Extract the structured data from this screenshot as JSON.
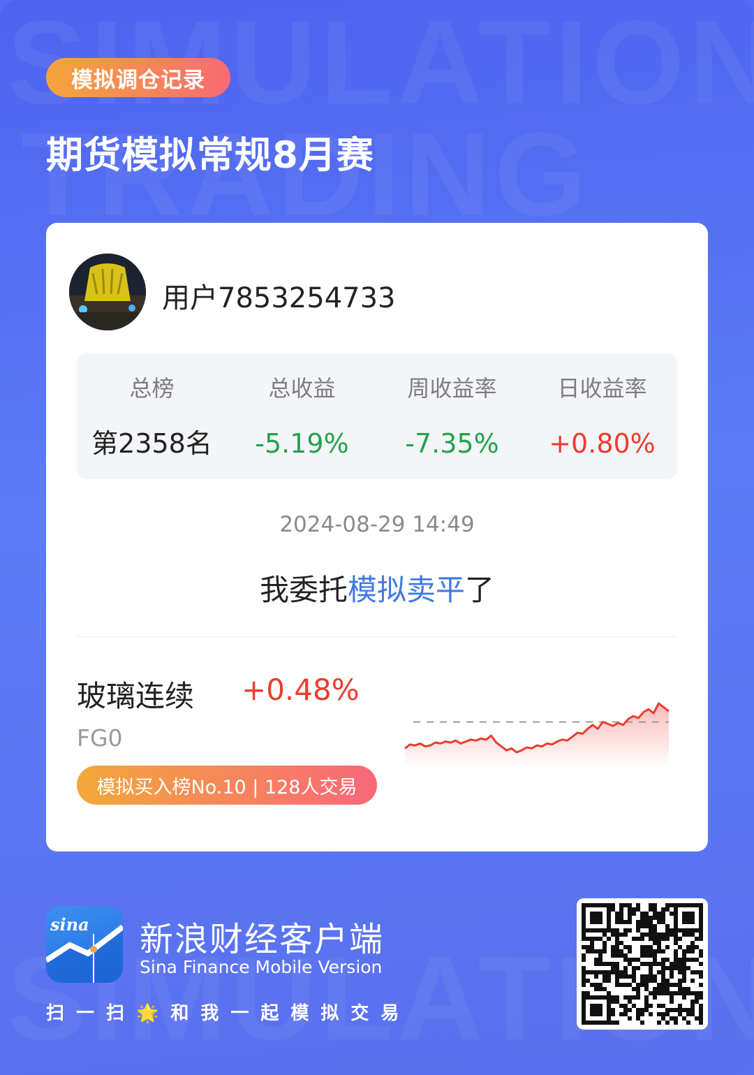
{
  "header": {
    "badge": "模拟调仓记录",
    "title": "期货模拟常规8月赛"
  },
  "user": {
    "name": "用户7853254733"
  },
  "stats": [
    {
      "label": "总榜",
      "value": "第2358名",
      "tone": "dark"
    },
    {
      "label": "总收益",
      "value": "-5.19%",
      "tone": "neg"
    },
    {
      "label": "周收益率",
      "value": "-7.35%",
      "tone": "neg"
    },
    {
      "label": "日收益率",
      "value": "+0.80%",
      "tone": "pos"
    }
  ],
  "record": {
    "timestamp": "2024-08-29 14:49",
    "action_prefix": "我委托",
    "action_highlight": "模拟卖平",
    "action_suffix": "了"
  },
  "contract": {
    "name": "玻璃连续",
    "change": "+0.48%",
    "code": "FG0",
    "rank_badge": "模拟买入榜No.10 | 128人交易"
  },
  "chart_data": {
    "type": "line",
    "series": [
      {
        "values": [
          0.0,
          0.4,
          0.3,
          0.5,
          0.2,
          0.3,
          0.6,
          0.5,
          0.7,
          0.6,
          0.8,
          0.5,
          0.7,
          0.9,
          0.8,
          1.0,
          0.9,
          1.3,
          0.6,
          0.2,
          -0.2,
          0.0,
          -0.4,
          -0.2,
          0.1,
          0.0,
          0.3,
          0.2,
          0.5,
          0.4,
          0.7,
          0.9,
          0.8,
          1.2,
          1.6,
          1.5,
          2.0,
          2.4,
          2.0,
          2.7,
          2.5,
          2.3,
          2.6,
          2.4,
          3.0,
          3.3,
          3.1,
          3.7,
          4.0,
          3.6,
          4.6,
          4.2,
          3.8
        ]
      }
    ],
    "baseline": 2.7,
    "colors": {
      "line": "#ec3c2e",
      "baseline": "#9a9a9a"
    }
  },
  "footer": {
    "app_logo_text": "sina",
    "app_name": "新浪财经客户端",
    "app_subtitle": "Sina Finance Mobile Version",
    "scan_text": "扫一扫🌟和我一起模拟交易"
  },
  "colors": {
    "background": "#5672f3",
    "accent_blue": "#3e79e6",
    "positive": "#ec3c2e",
    "negative": "#21a34a"
  }
}
